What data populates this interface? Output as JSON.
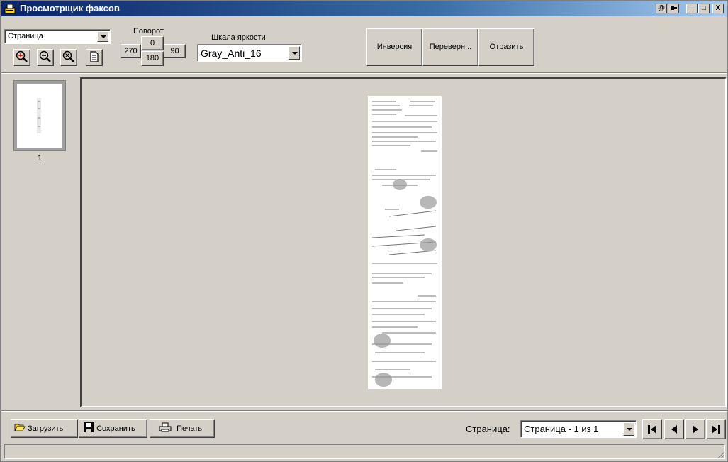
{
  "window": {
    "title": "Просмотрщик факсов",
    "controls": {
      "minimize": "_",
      "maximize": "□",
      "close": "X",
      "at": "@"
    }
  },
  "toolbar": {
    "view_mode": {
      "selected": "Страница"
    },
    "zoom": {
      "zoom_in_icon": "zoom-in-icon",
      "zoom_out_icon": "zoom-out-icon",
      "zoom_reset_icon": "zoom-reset-icon",
      "page_icon": "page-icon"
    },
    "rotation": {
      "label": "Поворот",
      "r0": "0",
      "r90": "90",
      "r180": "180",
      "r270": "270"
    },
    "brightness": {
      "label": "Шкала яркости",
      "selected": "Gray_Anti_16"
    },
    "inversion_label": "Инверсия",
    "flip_label": "Переверн...",
    "mirror_label": "Отразить"
  },
  "thumbnails": [
    {
      "number": "1"
    }
  ],
  "bottom": {
    "load_label": "Загрузить",
    "save_label": "Сохранить",
    "print_label": "Печать",
    "page_label": "Страница:",
    "page_selected": "Страница - 1 из 1"
  },
  "colors": {
    "titlebar_start": "#0a246a",
    "face": "#d4d0c8"
  }
}
